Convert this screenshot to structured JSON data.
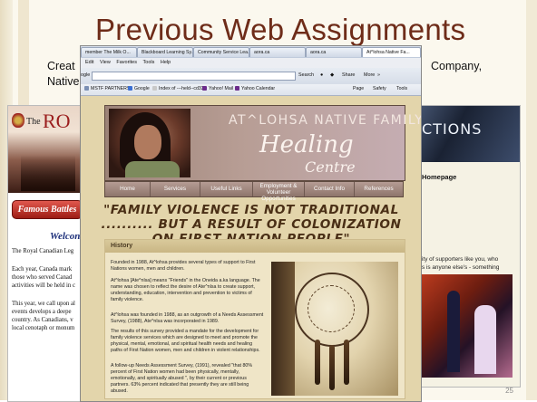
{
  "slide": {
    "title": "Previous Web Assignments",
    "line1_left": "Creat",
    "line1_right": "Company,",
    "line2_left": "Native",
    "page_number": "25"
  },
  "left_site": {
    "logo_prefix": "The",
    "logo_text": "RO",
    "button": "Famous Battles",
    "welcome": "Welcon",
    "paragraphs": [
      "The Royal Canadian Leg",
      "Each year, Canada mark",
      "those who served Canad",
      "activities will be held in c",
      "This year, we call upon al",
      "events develops a deepe",
      "country. As Canadians, v",
      "local cenotaph or monum"
    ]
  },
  "right_site": {
    "banner": "CTIONS",
    "homepage": "Homepage",
    "text_lines": [
      "ity of supporters like you, who",
      "s is anyone else's - something"
    ]
  },
  "browser": {
    "tabs": [
      "member The Milk O...",
      "Blackboard Learning Sy...",
      "Community Service Lea...",
      "aora.ca",
      "aora.ca",
      "At^lohsa Native Fa..."
    ],
    "menu": [
      "Edit",
      "View",
      "Favorites",
      "Tools",
      "Help"
    ],
    "address_label": "ogle",
    "address_items": [
      "Search",
      "Share",
      "More",
      "»"
    ],
    "favorites": [
      "MSTF PARTNERS",
      "Google",
      "Index of ---held--cd333",
      "Yahoo! Mail",
      "Yahoo Calendar"
    ],
    "fav_right": [
      "Page",
      "Safety",
      "Tools"
    ]
  },
  "healing_site": {
    "title_line1": "AT^LOHSA NATIVE FAMILY",
    "title_line2": "Healing",
    "title_line3": "Centre",
    "nav": [
      "Home",
      "Services",
      "Useful Links",
      "Employment & Volunteer Opportunities",
      "Contact Info",
      "References"
    ],
    "banner": "\"FAMILY VIOLENCE IS NOT TRADITIONAL .......... BUT A RESULT OF COLONIZATION ON FIRST NATION PEOPLE\"",
    "section_heading": "History",
    "paragraphs": [
      "Founded in 1988, At^lohsa provides several types of support to First Nations women, men and children.",
      "At^lohsa [Ate^nlsa] means \"Friends\" in the Oneida a.ka language. The name was chosen to reflect the desire of Ate^nlsa to create support, understanding, education, intervention and prevention to victims of family violence.",
      "At^lohsa was founded in 1988, as an outgrowth of a Needs Assessment Survey, (1988), Ate^nlsa was incorporated in 1989.",
      "The results of this survey provided a mandate for the development for family violence services which are designed to meet and promote the physical, mental, emotional, and spiritual health needs and healing paths of First Nation women, men and children in violent relationships.",
      "A follow-up Needs Assessment Survey, (1991), revealed \"that 80% percent of First Nation women had been physically, mentally, emotionally, and spiritually abused \", by their current or previous partners. 63% percent indicated that presently they are still being abused."
    ]
  }
}
